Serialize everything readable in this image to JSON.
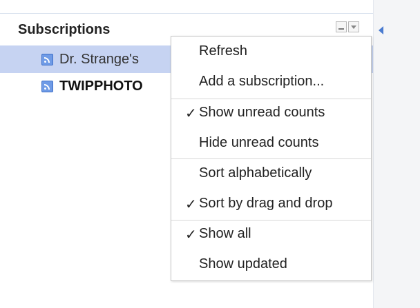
{
  "panel": {
    "title": "Subscriptions",
    "minimize_icon": "minimize-icon",
    "menu_icon": "dropdown-arrow-icon",
    "collapse_icon": "collapse-left-icon"
  },
  "subscriptions": [
    {
      "label": "Dr. Strange's",
      "selected": true,
      "bold": false,
      "icon": "feed-icon"
    },
    {
      "label": "TWIPPHOTO",
      "selected": false,
      "bold": true,
      "icon": "feed-icon"
    }
  ],
  "menu": {
    "check_glyph": "✓",
    "items": [
      {
        "label": "Refresh",
        "checked": false
      },
      {
        "label": "Add a subscription...",
        "checked": false
      },
      {
        "label": "Show unread counts",
        "checked": true
      },
      {
        "label": "Hide unread counts",
        "checked": false
      },
      {
        "label": "Sort alphabetically",
        "checked": false
      },
      {
        "label": "Sort by drag and drop",
        "checked": true
      },
      {
        "label": "Show all",
        "checked": true
      },
      {
        "label": "Show updated",
        "checked": false
      }
    ]
  },
  "colors": {
    "selected_row": "#c6d3f2",
    "accent": "#4a7bd0"
  }
}
